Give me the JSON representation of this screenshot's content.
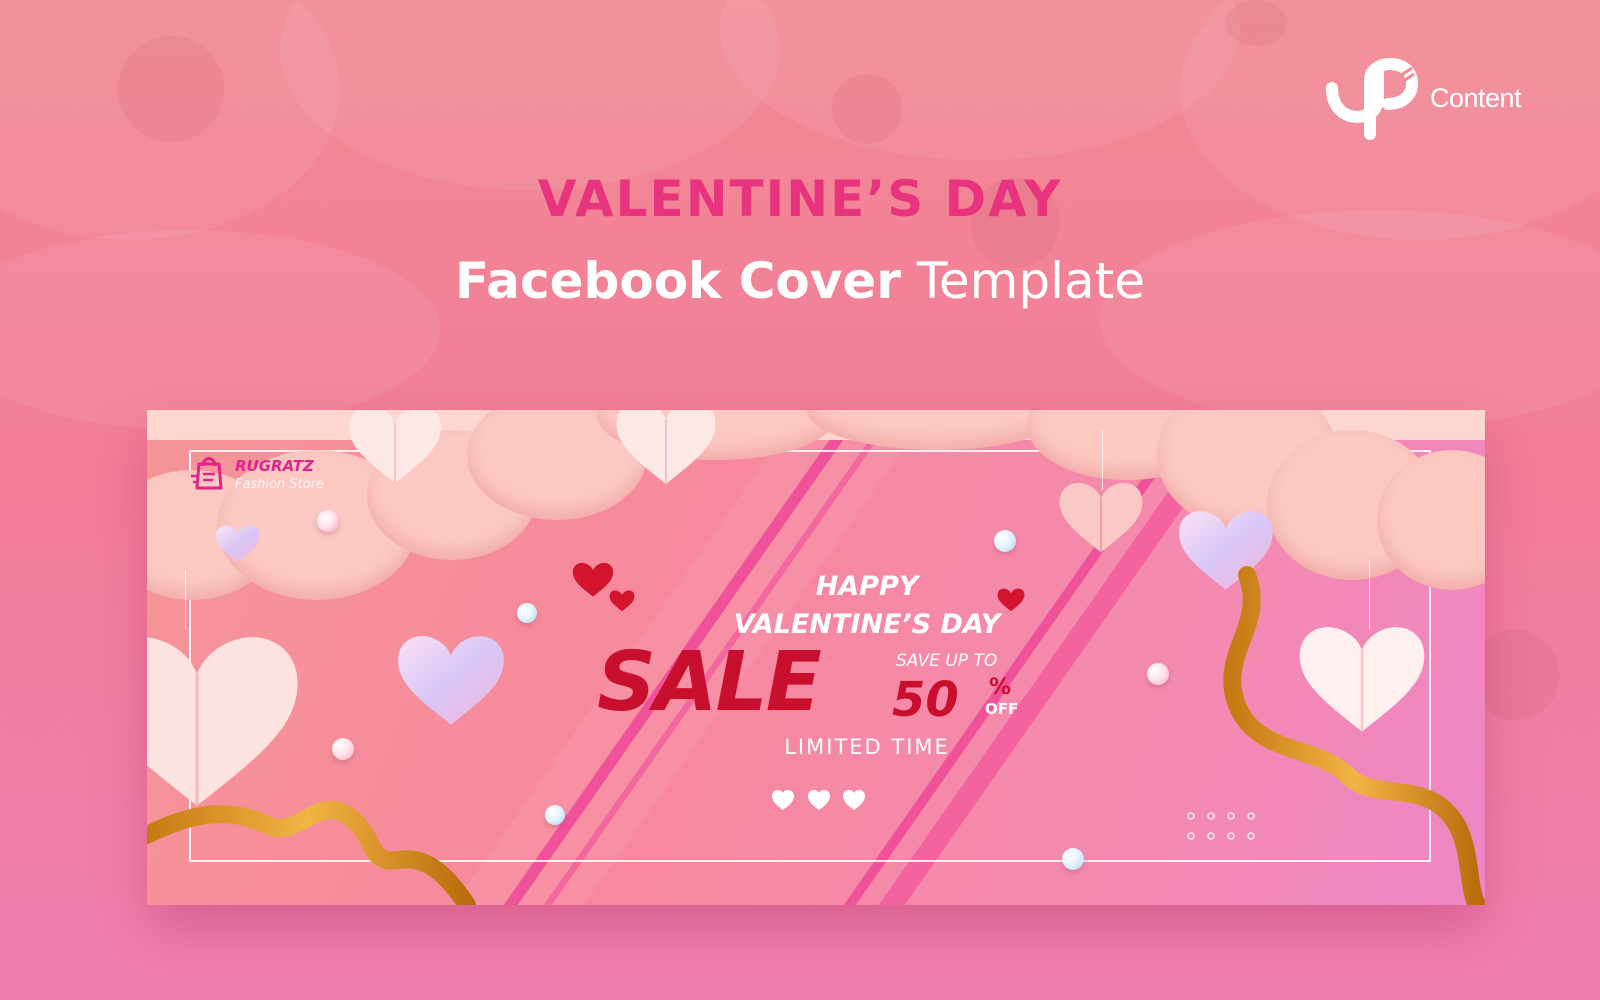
{
  "brand": {
    "name": "Content",
    "icon": "jp-logo-icon"
  },
  "headline": "VALENTINE’S DAY",
  "subheadline": {
    "bold": "Facebook Cover",
    "light": "Template"
  },
  "cover": {
    "store": {
      "name": "RUGRATZ",
      "tagline": "Fashion Store",
      "icon": "shopping-bag-icon"
    },
    "greeting_line1": "HAPPY",
    "greeting_line2": "VALENTINE’S DAY",
    "sale": "SALE",
    "save_up_to": "SAVE UP TO",
    "discount_number": "50",
    "discount_percent": "%",
    "discount_off": "OFF",
    "limited": "LIMITED TIME"
  },
  "colors": {
    "accent_pink": "#e8337f",
    "sale_red": "#c8102e",
    "background": "#f18a94"
  }
}
